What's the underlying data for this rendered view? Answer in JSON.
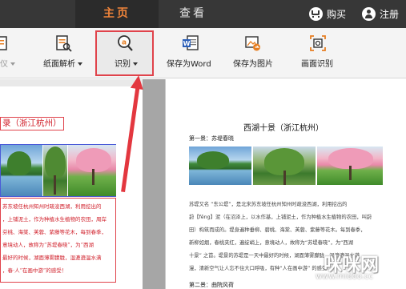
{
  "topbar": {
    "tabs": [
      {
        "label": "主页"
      },
      {
        "label": "查看"
      }
    ],
    "buy_label": "购买",
    "register_label": "注册"
  },
  "toolbar": {
    "items": [
      {
        "label": "仪"
      },
      {
        "label": "纸面解析"
      },
      {
        "label": "识别"
      },
      {
        "label": "保存为Word"
      },
      {
        "label": "保存为图片"
      },
      {
        "label": "画面识别"
      }
    ]
  },
  "left_page": {
    "title": "录（浙江杭州）",
    "lines": [
      "苏东坡任杭州知州时疏浚西湖，利用挖出的",
      "，上铺泥土，作为种植水生植物的农田，周岸",
      "芬桃、海棠、芙蓉、紫藤等花木，每到春季，",
      "意境动人，故称为“苏堤春晓”，为“西湖",
      "最好的时候，湖面薄雾朦胧，湿漉漉温水满",
      "，春·人“在画中游”的感受！"
    ]
  },
  "right_page": {
    "title": "西湖十景（浙江杭州）",
    "subtitle1": "第一景：苏堤春晓",
    "lines": [
      "苏堤又名 “东公堤”，是北宋苏东坡任杭州知州时疏浚西湖，利用挖出的",
      "葑【fēng】泥（在沼泽上，以水作基，上铺泥土，作为种植水生植物的农田，叫葑",
      "田）构筑而成的。堤身遍种垂柳、碧桃、海棠、芙蓉、紫藤等花木。每到春季，",
      "新柳如烟，春桃夹红，遍绽峭上，意境动人，故称为“苏堤春晓”，为“西湖",
      "十景” 之首。堤景的苏堤是一天中最好的时候，湖面薄雾朦胧，湿漉漉温水满",
      "漫，清新空气让人忘不住大口呼吸，有种“人在画中游” 的感受！"
    ],
    "subtitle2": "第二景：曲院风荷"
  },
  "watermark": {
    "text": "咪咪网",
    "url": "www.midoo.cc"
  },
  "colors": {
    "accent_orange": "#f0843a",
    "highlight_red": "#e0434b",
    "topbar": "#373737"
  }
}
